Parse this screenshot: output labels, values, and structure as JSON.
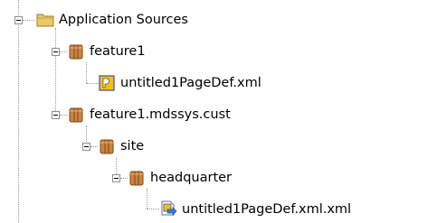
{
  "tree": {
    "nodes": [
      {
        "label": "Application Sources",
        "icon": "folder-icon"
      },
      {
        "label": "feature1",
        "icon": "package-icon"
      },
      {
        "label": "untitled1PageDef.xml",
        "icon": "pagedef-file-icon"
      },
      {
        "label": "feature1.mdssys.cust",
        "icon": "package-icon"
      },
      {
        "label": "site",
        "icon": "package-icon"
      },
      {
        "label": "headquarter",
        "icon": "package-icon"
      },
      {
        "label": "untitled1PageDef.xml.xml",
        "icon": "customization-file-icon"
      }
    ]
  },
  "colors": {
    "folder": "#e8c96a",
    "package": "#c9843e",
    "pagedef": "#f5c400",
    "guide_line": "#9a9a9a"
  }
}
